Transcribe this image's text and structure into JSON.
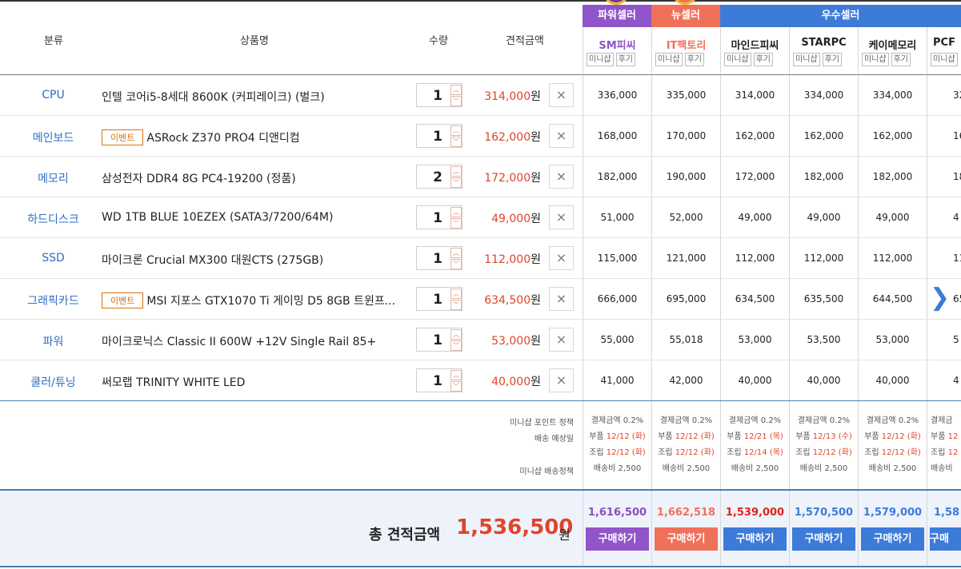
{
  "header": {
    "category": "분류",
    "product": "상품명",
    "quantity": "수량",
    "amount": "견적금액"
  },
  "groups": {
    "power": "파워셀러",
    "new": "뉴셀러",
    "good": "우수셀러"
  },
  "sellers": [
    {
      "name": "SM피씨",
      "color": "#9055c8",
      "mini": "미니샵",
      "review": "후기"
    },
    {
      "name": "IT팩토리",
      "color": "#f0715a",
      "mini": "미니샵",
      "review": "후기"
    },
    {
      "name": "마인드피씨",
      "color": "#222222",
      "mini": "미니샵",
      "review": "후기"
    },
    {
      "name": "STARPC",
      "color": "#222222",
      "mini": "미니샵",
      "review": "후기"
    },
    {
      "name": "케이메모리",
      "color": "#222222",
      "mini": "미니샵",
      "review": "후기"
    },
    {
      "name": "PCF",
      "color": "#222222",
      "mini": "미니샵",
      "review": ""
    }
  ],
  "event_label": "이벤트",
  "won": "원",
  "delete_icon": "×",
  "rows": [
    {
      "cat": "CPU",
      "event": false,
      "name": "인텔 코어i5-8세대 8600K (커피레이크) (벌크)",
      "qty": "1",
      "price": "314,000",
      "sp": [
        "336,000",
        "335,000",
        "314,000",
        "334,000",
        "334,000",
        "32"
      ]
    },
    {
      "cat": "메인보드",
      "event": true,
      "name": "ASRock Z370 PRO4 디앤디컴",
      "qty": "1",
      "price": "162,000",
      "sp": [
        "168,000",
        "170,000",
        "162,000",
        "162,000",
        "162,000",
        "16"
      ]
    },
    {
      "cat": "메모리",
      "event": false,
      "name": "삼성전자 DDR4 8G PC4-19200 (정품)",
      "qty": "2",
      "price": "172,000",
      "sp": [
        "182,000",
        "190,000",
        "172,000",
        "182,000",
        "182,000",
        "18"
      ]
    },
    {
      "cat": "하드디스크",
      "event": false,
      "name": "WD 1TB BLUE 10EZEX (SATA3/7200/64M)",
      "qty": "1",
      "price": "49,000",
      "sp": [
        "51,000",
        "52,000",
        "49,000",
        "49,000",
        "49,000",
        "4"
      ]
    },
    {
      "cat": "SSD",
      "event": false,
      "name": "마이크론 Crucial MX300 대원CTS (275GB)",
      "qty": "1",
      "price": "112,000",
      "sp": [
        "115,000",
        "121,000",
        "112,000",
        "112,000",
        "112,000",
        "11"
      ]
    },
    {
      "cat": "그래픽카드",
      "event": true,
      "name": "MSI 지포스 GTX1070 Ti 게이밍 D5 8GB 트윈프...",
      "qty": "1",
      "price": "634,500",
      "sp": [
        "666,000",
        "695,000",
        "634,500",
        "635,500",
        "644,500",
        "65"
      ]
    },
    {
      "cat": "파워",
      "event": false,
      "name": "마이크로닉스 Classic II 600W +12V Single Rail 85+",
      "qty": "1",
      "price": "53,000",
      "sp": [
        "55,000",
        "55,018",
        "53,000",
        "53,500",
        "53,000",
        "5"
      ]
    },
    {
      "cat": "쿨러/튜닝",
      "event": false,
      "name": "써모랩 TRINITY WHITE LED",
      "qty": "1",
      "price": "40,000",
      "sp": [
        "41,000",
        "42,000",
        "40,000",
        "40,000",
        "40,000",
        "4"
      ]
    }
  ],
  "policy_labels": {
    "point": "미니샵 포인트 정책",
    "delivery": "배송 예상일",
    "shipping": "미니샵 배송정책"
  },
  "policies": [
    {
      "point": "결제금액 0.2%",
      "parts_label": "부품",
      "parts_date": "12/12 (화)",
      "asm_label": "조립",
      "asm_date": "12/12 (화)",
      "ship": "배송비 2,500"
    },
    {
      "point": "결제금액 0.2%",
      "parts_label": "부품",
      "parts_date": "12/12 (화)",
      "asm_label": "조립",
      "asm_date": "12/12 (화)",
      "ship": "배송비 2,500"
    },
    {
      "point": "결제금액 0.2%",
      "parts_label": "부품",
      "parts_date": "12/21 (목)",
      "asm_label": "조립",
      "asm_date": "12/14 (목)",
      "ship": "배송비 2,500"
    },
    {
      "point": "결제금액 0.2%",
      "parts_label": "부품",
      "parts_date": "12/13 (수)",
      "asm_label": "조립",
      "asm_date": "12/12 (화)",
      "ship": "배송비 2,500"
    },
    {
      "point": "결제금액 0.2%",
      "parts_label": "부품",
      "parts_date": "12/12 (화)",
      "asm_label": "조립",
      "asm_date": "12/12 (화)",
      "ship": "배송비 2,500"
    },
    {
      "point": "결제금",
      "parts_label": "부품",
      "parts_date": "12",
      "asm_label": "조립",
      "asm_date": "12",
      "ship": "배송비"
    }
  ],
  "total": {
    "label": "총 견적금액",
    "value": "1,536,500",
    "won": "원"
  },
  "seller_totals": [
    {
      "value": "1,616,500",
      "color": "#8a4fbf",
      "btn": "구매하기",
      "btn_color": "#9055c8"
    },
    {
      "value": "1,662,518",
      "color": "#f0715a",
      "btn": "구매하기",
      "btn_color": "#f0715a"
    },
    {
      "value": "1,539,000",
      "color": "#e0251a",
      "btn": "구매하기",
      "btn_color": "#3d7bd8"
    },
    {
      "value": "1,570,500",
      "color": "#3d7bd8",
      "btn": "구매하기",
      "btn_color": "#3d7bd8"
    },
    {
      "value": "1,579,000",
      "color": "#3d7bd8",
      "btn": "구매하기",
      "btn_color": "#3d7bd8"
    },
    {
      "value": "1,58",
      "color": "#3d7bd8",
      "btn": "구매",
      "btn_color": "#3d7bd8"
    }
  ]
}
